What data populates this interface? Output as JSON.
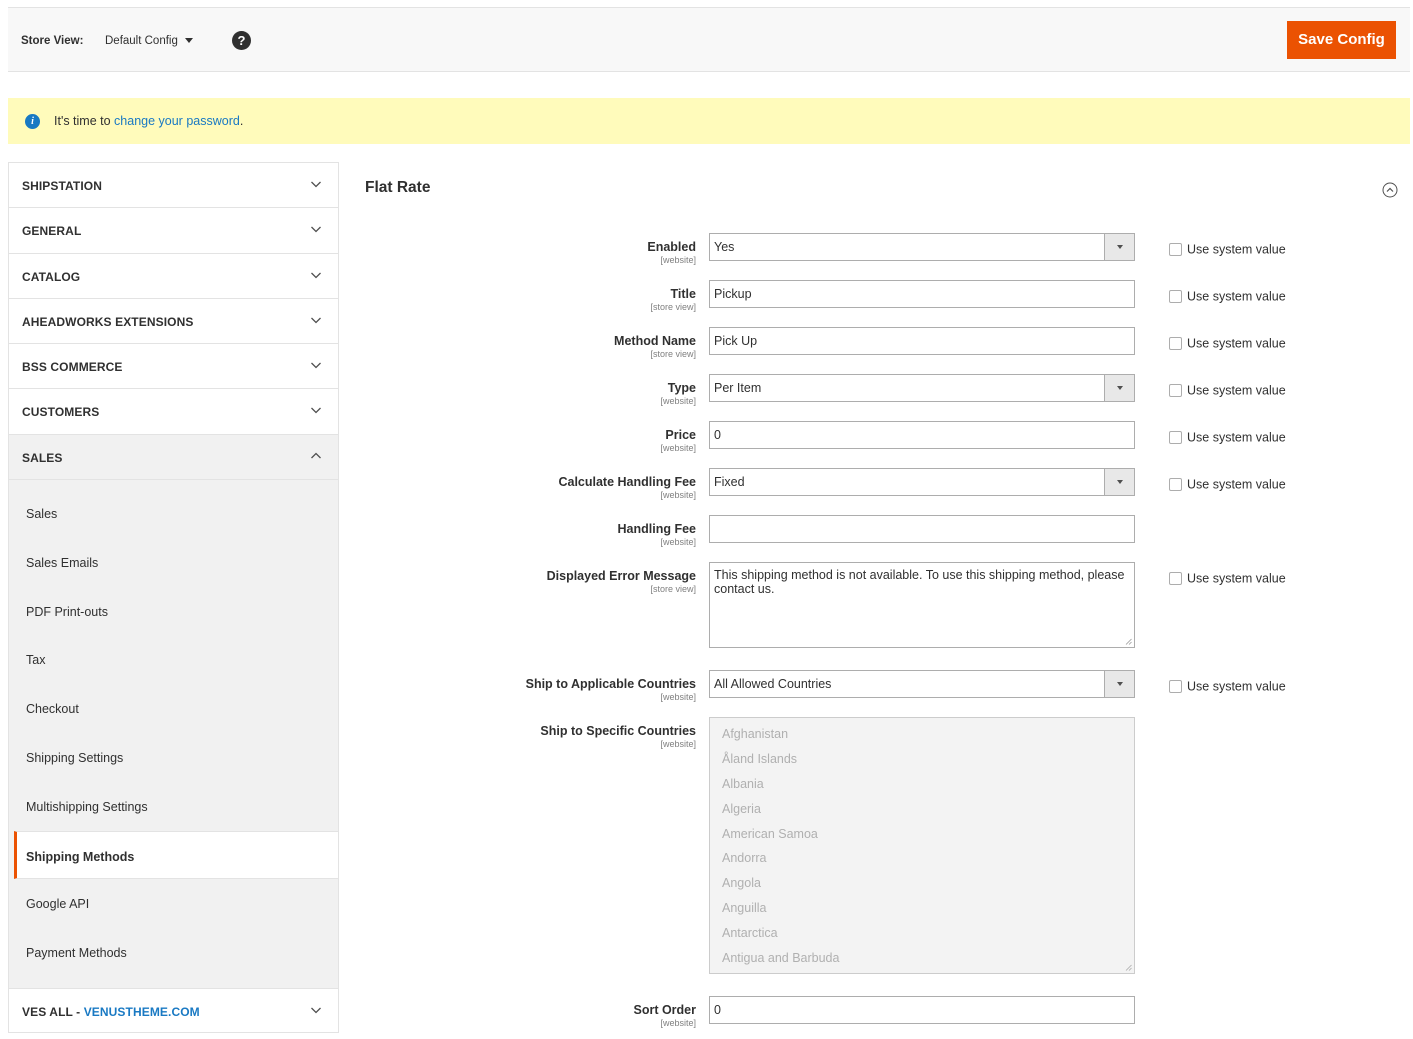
{
  "header": {
    "store_view_label": "Store View:",
    "store_view_value": "Default Config",
    "help_icon": "question-circle-icon",
    "save_button": "Save Config"
  },
  "notice": {
    "icon": "info-icon",
    "text_before": "It's time to ",
    "link_text": "change your password",
    "text_after": "."
  },
  "sidebar": {
    "sections": [
      {
        "label": "SHIPSTATION",
        "expanded": false
      },
      {
        "label": "GENERAL",
        "expanded": false
      },
      {
        "label": "CATALOG",
        "expanded": false
      },
      {
        "label": "AHEADWORKS EXTENSIONS",
        "expanded": false
      },
      {
        "label": "BSS COMMERCE",
        "expanded": false
      },
      {
        "label": "CUSTOMERS",
        "expanded": false
      },
      {
        "label": "SALES",
        "expanded": true
      }
    ],
    "sales_items": [
      {
        "label": "Sales"
      },
      {
        "label": "Sales Emails"
      },
      {
        "label": "PDF Print-outs"
      },
      {
        "label": "Tax"
      },
      {
        "label": "Checkout"
      },
      {
        "label": "Shipping Settings"
      },
      {
        "label": "Multishipping Settings"
      },
      {
        "label": "Shipping Methods",
        "active": true
      },
      {
        "label": "Google API"
      },
      {
        "label": "Payment Methods"
      }
    ],
    "last_section": {
      "label_prefix": "VES ALL - ",
      "label_highlight": "VENUSTHEME.COM",
      "expanded": false
    },
    "accent_color": "#eb5202",
    "link_color": "#1979c3"
  },
  "main": {
    "section_title": "Flat Rate",
    "use_system_value_label": "Use system value",
    "fields": {
      "enabled": {
        "label": "Enabled",
        "scope": "[website]",
        "value": "Yes",
        "type": "select",
        "use_system": false
      },
      "title": {
        "label": "Title",
        "scope": "[store view]",
        "value": "Pickup",
        "type": "text",
        "use_system": false
      },
      "method_name": {
        "label": "Method Name",
        "scope": "[store view]",
        "value": "Pick Up",
        "type": "text",
        "use_system": false
      },
      "type": {
        "label": "Type",
        "scope": "[website]",
        "value": "Per Item",
        "type": "select",
        "use_system": false
      },
      "price": {
        "label": "Price",
        "scope": "[website]",
        "value": "0",
        "type": "text",
        "use_system": false
      },
      "calc_handling_fee": {
        "label": "Calculate Handling Fee",
        "scope": "[website]",
        "value": "Fixed",
        "type": "select",
        "use_system": false
      },
      "handling_fee": {
        "label": "Handling Fee",
        "scope": "[website]",
        "value": "",
        "type": "text"
      },
      "error_message": {
        "label": "Displayed Error Message",
        "scope": "[store view]",
        "value": "This shipping method is not available. To use this shipping method, please contact us.",
        "type": "textarea",
        "use_system": false
      },
      "applicable_countries": {
        "label": "Ship to Applicable Countries",
        "scope": "[website]",
        "value": "All Allowed Countries",
        "type": "select",
        "use_system": false
      },
      "specific_countries": {
        "label": "Ship to Specific Countries",
        "scope": "[website]",
        "type": "multiselect",
        "disabled": true,
        "options": [
          "Afghanistan",
          "Åland Islands",
          "Albania",
          "Algeria",
          "American Samoa",
          "Andorra",
          "Angola",
          "Anguilla",
          "Antarctica",
          "Antigua and Barbuda"
        ]
      },
      "sort_order": {
        "label": "Sort Order",
        "scope": "[website]",
        "value": "0",
        "type": "text"
      }
    }
  }
}
